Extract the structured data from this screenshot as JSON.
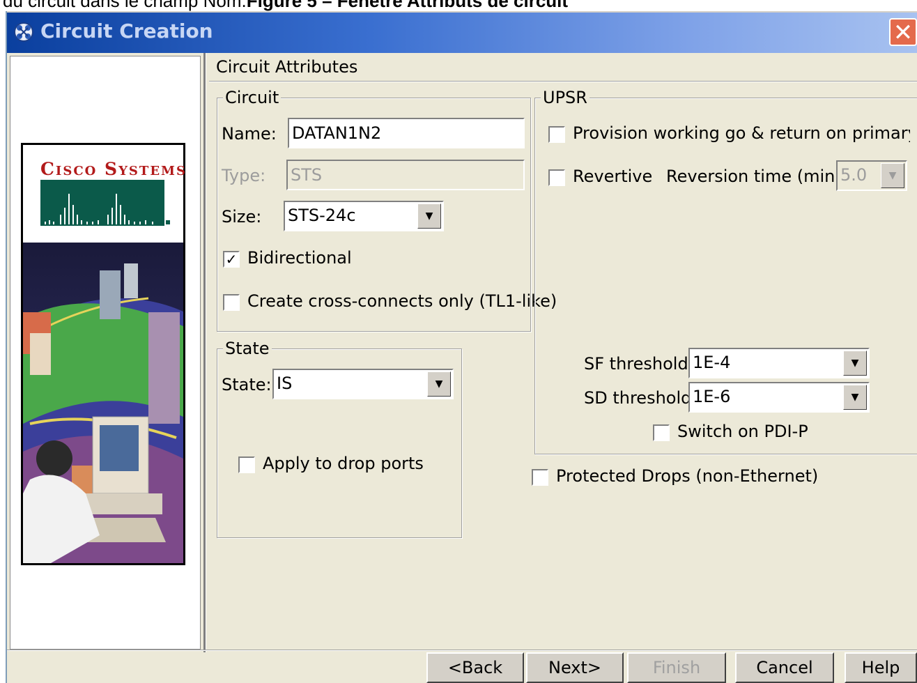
{
  "caption": {
    "prefix": "du circuit dans le champ Nom.",
    "bold": "Figure 5 – Fenêtre Attributs de circuit"
  },
  "window": {
    "title": "Circuit Creation",
    "close": "✕"
  },
  "logo": {
    "brand": "Cisco Systems"
  },
  "panel": {
    "title": "Circuit Attributes"
  },
  "circuit": {
    "legend": "Circuit",
    "name_label": "Name:",
    "name_value": "DATAN1N2",
    "type_label": "Type:",
    "type_value": "STS",
    "size_label": "Size:",
    "size_value": "STS-24c",
    "bidirectional_label": "Bidirectional",
    "bidirectional_checked": "✓",
    "crossconnect_label": "Create cross-connects only (TL1-like)"
  },
  "state": {
    "legend": "State",
    "state_label": "State:",
    "state_value": "IS",
    "apply_label": "Apply to drop ports"
  },
  "upsr": {
    "legend": "UPSR",
    "provision_label": "Provision working go & return on primary path",
    "revertive_label": "Revertive",
    "reversion_label": "Reversion time (min):",
    "reversion_value": "5.0",
    "sf_label": "SF threshold:",
    "sf_value": "1E-4",
    "sd_label": "SD threshold:",
    "sd_value": "1E-6",
    "pdi_label": "Switch on PDI-P"
  },
  "protected_label": "Protected Drops (non-Ethernet)",
  "buttons": {
    "back": "<Back",
    "next": "Next>",
    "finish": "Finish",
    "cancel": "Cancel",
    "help": "Help"
  }
}
